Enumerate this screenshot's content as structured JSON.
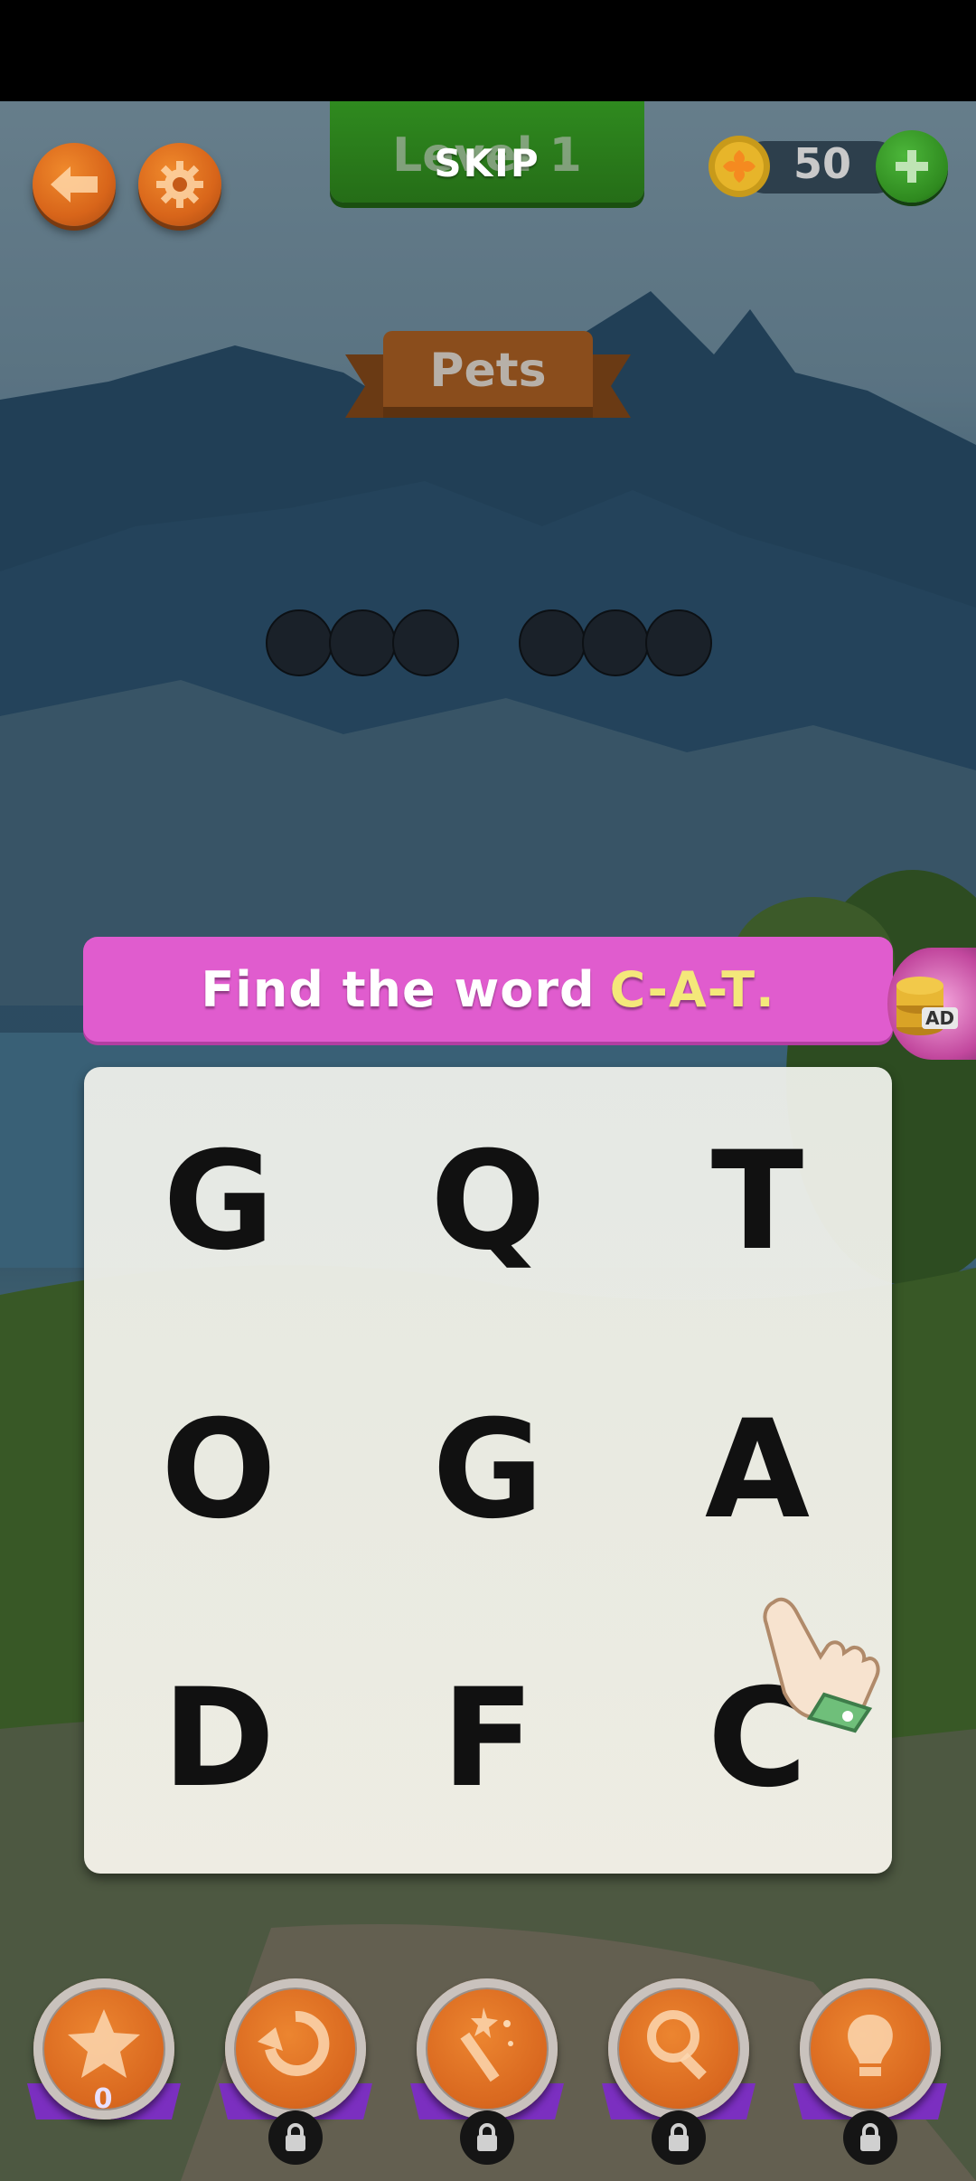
{
  "header": {
    "level_label": "Level 1",
    "skip_label": "SKIP",
    "coins": "50"
  },
  "category": "Pets",
  "answer_slots": {
    "word1_length": 3,
    "word2_length": 3
  },
  "instruction": {
    "prefix": "Find the word",
    "target": "C-A-T",
    "suffix": "."
  },
  "ad_badge": "AD",
  "grid": [
    [
      "G",
      "Q",
      "T"
    ],
    [
      "O",
      "G",
      "A"
    ],
    [
      "D",
      "F",
      "C"
    ]
  ],
  "boosters": {
    "star_count": "0",
    "items": [
      "star-icon",
      "undo-icon",
      "magic-wand-icon",
      "magnifier-icon",
      "lightbulb-icon"
    ]
  },
  "colors": {
    "instruction_bg": "#e05cce",
    "target_highlight": "#f4e87a",
    "level_banner": "#2f8a1f",
    "booster_orange": "#d9681f",
    "ribbon_purple": "#7b2fc0"
  }
}
